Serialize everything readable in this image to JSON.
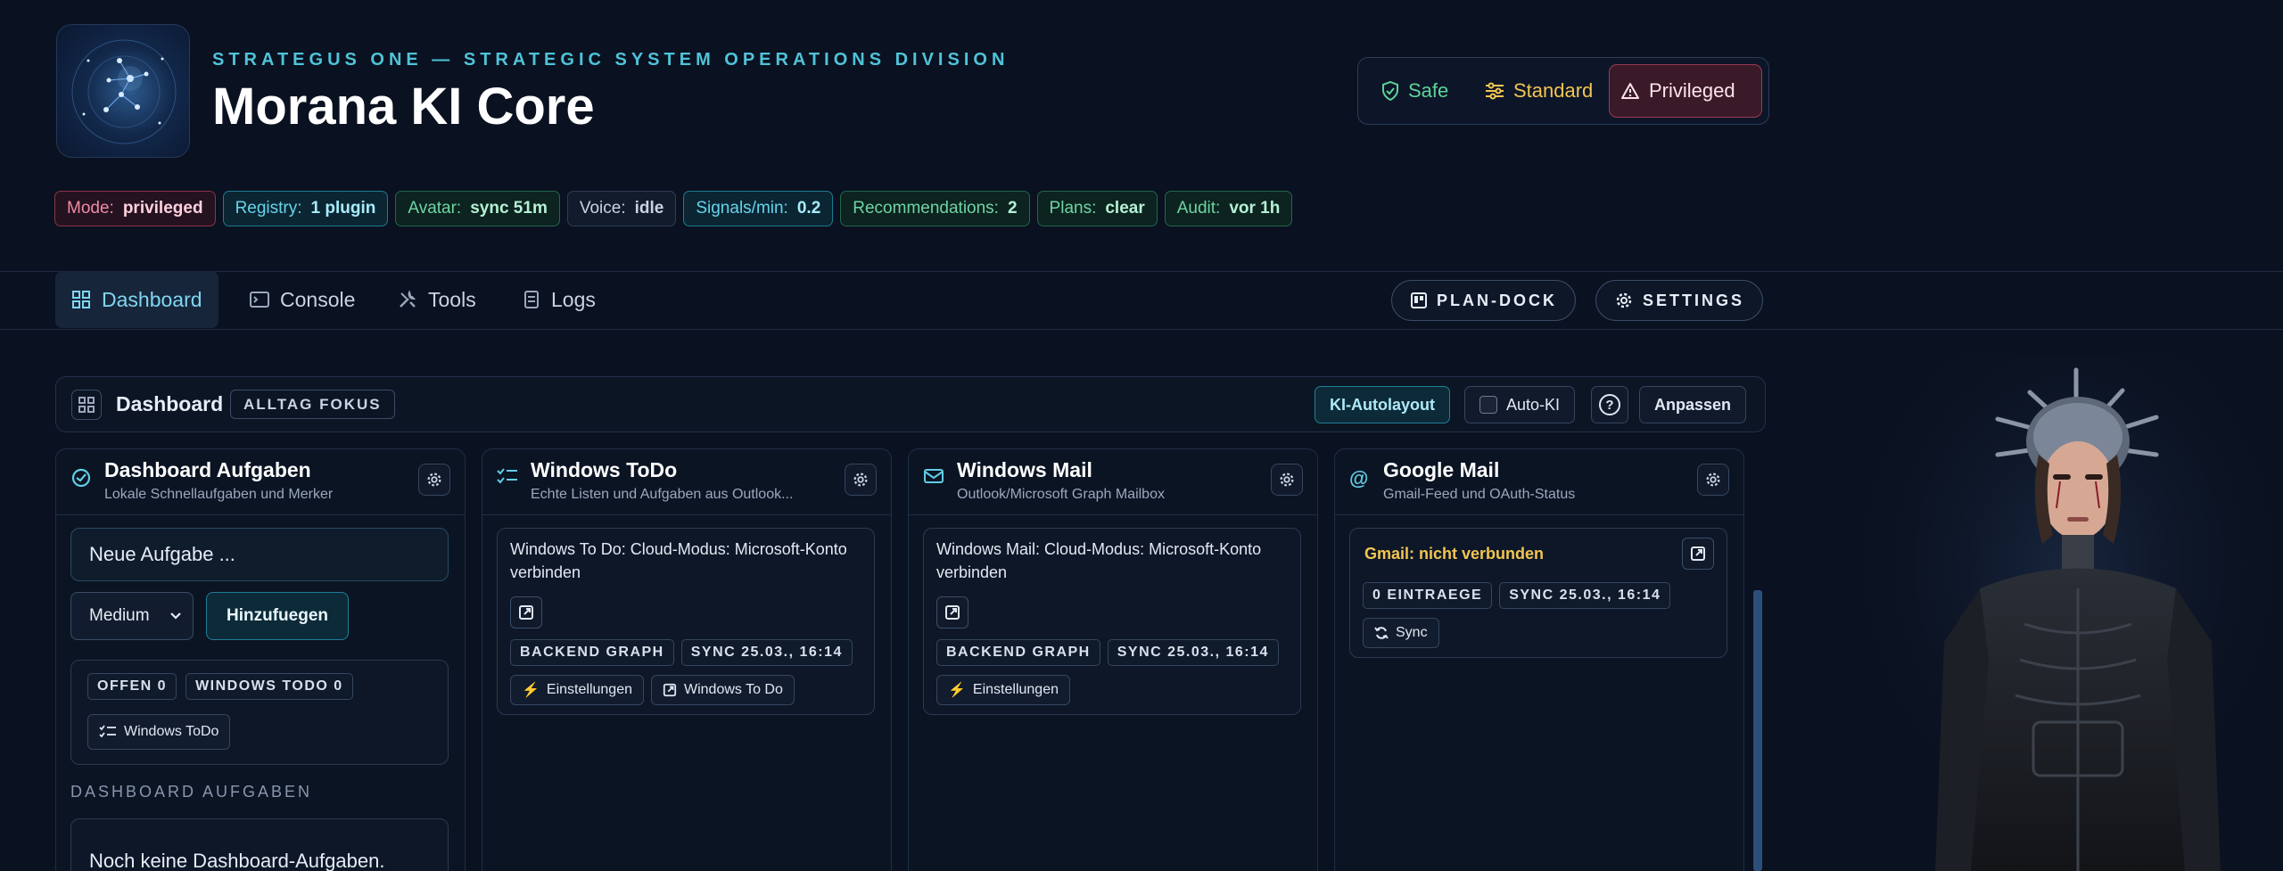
{
  "header": {
    "division": "STRATEGUS ONE — STRATEGIC SYSTEM OPERATIONS DIVISION",
    "title": "Morana KI Core",
    "logo_icon": "constellation-logo-icon"
  },
  "modes": {
    "safe": "Safe",
    "standard": "Standard",
    "privileged": "Privileged",
    "active": "privileged"
  },
  "chips": [
    {
      "label": "Mode:",
      "value": "privileged"
    },
    {
      "label": "Registry:",
      "value": "1 plugin"
    },
    {
      "label": "Avatar:",
      "value": "sync 51m"
    },
    {
      "label": "Voice:",
      "value": "idle"
    },
    {
      "label": "Signals/min:",
      "value": "0.2"
    },
    {
      "label": "Recommendations:",
      "value": "2"
    },
    {
      "label": "Plans:",
      "value": "clear"
    },
    {
      "label": "Audit:",
      "value": "vor 1h"
    }
  ],
  "nav": {
    "tabs": [
      {
        "label": "Dashboard",
        "icon": "grid-icon",
        "active": true
      },
      {
        "label": "Console",
        "icon": "terminal-icon"
      },
      {
        "label": "Tools",
        "icon": "tools-icon"
      },
      {
        "label": "Logs",
        "icon": "document-icon"
      }
    ],
    "plan_dock": "PLAN-DOCK",
    "settings": "SETTINGS"
  },
  "dashboard": {
    "title": "Dashboard",
    "focus_badge": "ALLTAG FOKUS",
    "autolayout": "KI-Autolayout",
    "auto_ki": "Auto-KI",
    "help": "?",
    "customize": "Anpassen"
  },
  "columns": {
    "tasks": {
      "title": "Dashboard Aufgaben",
      "subtitle": "Lokale Schnellaufgaben und Merker",
      "input_placeholder": "Neue Aufgabe ...",
      "priority": "Medium",
      "add": "Hinzufuegen",
      "open_tag": "OFFEN 0",
      "todo_tag": "WINDOWS TODO 0",
      "todo_button": "Windows ToDo",
      "section": "DASHBOARD AUFGABEN",
      "empty": "Noch keine Dashboard-Aufgaben."
    },
    "todo": {
      "title": "Windows ToDo",
      "subtitle": "Echte Listen und Aufgaben aus Outlook...",
      "text": "Windows To Do: Cloud-Modus: Microsoft-Konto verbinden",
      "tag_backend": "BACKEND GRAPH",
      "tag_sync": "SYNC 25.03., 16:14",
      "settings": "Einstellungen",
      "open_app": "Windows To Do"
    },
    "mail": {
      "title": "Windows Mail",
      "subtitle": "Outlook/Microsoft Graph Mailbox",
      "text": "Windows Mail: Cloud-Modus: Microsoft-Konto verbinden",
      "tag_backend": "BACKEND GRAPH",
      "tag_sync": "SYNC 25.03., 16:14",
      "settings": "Einstellungen"
    },
    "gmail": {
      "title": "Google Mail",
      "subtitle": "Gmail-Feed und OAuth-Status",
      "status": "Gmail: nicht verbunden",
      "tag_entries": "0 EINTRAEGE",
      "tag_sync": "SYNC 25.03., 16:14",
      "sync": "Sync"
    }
  },
  "colors": {
    "accent": "#4fc3d8",
    "safe": "#5ed39a",
    "standard": "#f2c552",
    "privileged": "#9a3b55",
    "gmail_warning": "#f2c552"
  }
}
